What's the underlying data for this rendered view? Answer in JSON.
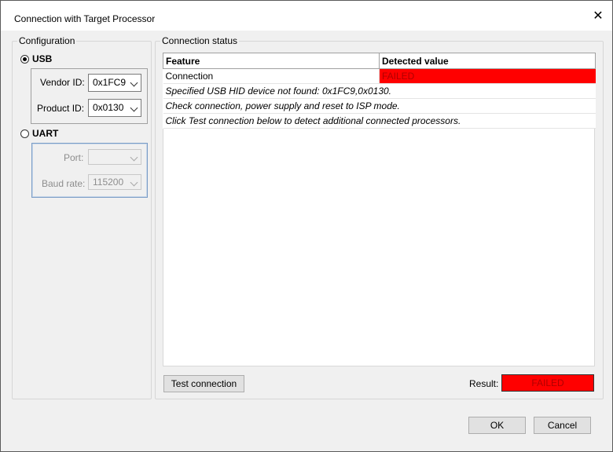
{
  "window": {
    "title": "Connection with Target Processor"
  },
  "configuration": {
    "label": "Configuration",
    "usb": {
      "label": "USB",
      "selected": true,
      "vendor_id_label": "Vendor ID:",
      "vendor_id_value": "0x1FC9",
      "product_id_label": "Product ID:",
      "product_id_value": "0x0130"
    },
    "uart": {
      "label": "UART",
      "selected": false,
      "port_label": "Port:",
      "port_value": "",
      "baud_label": "Baud rate:",
      "baud_value": "115200"
    }
  },
  "status": {
    "label": "Connection status",
    "columns": [
      "Feature",
      "Detected value"
    ],
    "rows": [
      {
        "feature": "Connection",
        "value": "FAILED"
      },
      {
        "feature": "Specified USB HID device not found: 0x1FC9,0x0130.",
        "value": ""
      },
      {
        "feature": "Check connection, power supply and reset to ISP mode.",
        "value": ""
      },
      {
        "feature": "Click Test connection below to detect additional connected processors.",
        "value": ""
      }
    ],
    "test_button": "Test connection",
    "result_label": "Result:",
    "result_value": "FAILED"
  },
  "footer": {
    "ok": "OK",
    "cancel": "Cancel"
  },
  "colors": {
    "failed": "#ff0000"
  }
}
